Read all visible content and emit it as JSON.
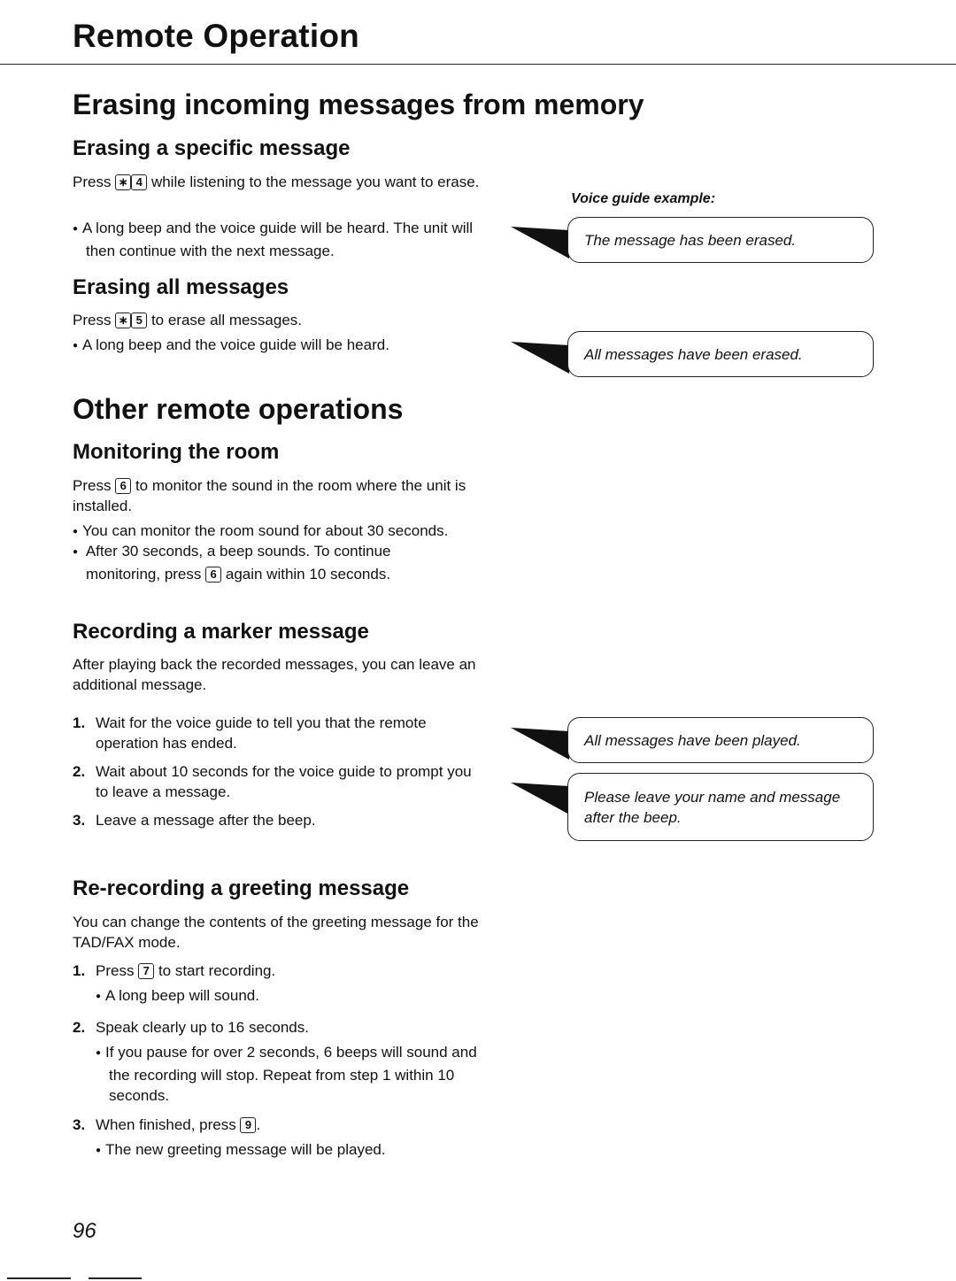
{
  "header": {
    "title": "Remote Operation"
  },
  "section_erasing": {
    "title": "Erasing incoming messages from memory",
    "specific": {
      "heading": "Erasing a specific message",
      "text_before": "Press",
      "keys": [
        "∗",
        "4"
      ],
      "text_after": "while listening to the message you want to erase.",
      "bullets": [
        "A long beep and the voice guide will be heard. The unit will then continue with the next message."
      ]
    },
    "all": {
      "heading": "Erasing all messages",
      "text_before": "Press",
      "keys": [
        "∗",
        "5"
      ],
      "text_after": "to erase all messages.",
      "bullets": [
        "A long beep and the voice guide will be heard."
      ]
    }
  },
  "voice_guide": {
    "label": "Voice guide example:",
    "bubbles": [
      "The message has been erased.",
      "All messages have been erased.",
      "All messages have been played.",
      "Please leave your name and message after the beep."
    ]
  },
  "section_other": {
    "title": "Other remote operations",
    "monitoring": {
      "heading": "Monitoring the room",
      "text_before": "Press",
      "key": "6",
      "text_after": "to monitor the sound in the room where the unit is installed.",
      "bullet1": "You can monitor the room sound for about 30 seconds.",
      "bullet2_before": "After 30 seconds, a beep sounds. To continue monitoring, press",
      "bullet2_key": "6",
      "bullet2_after": "again within 10 seconds."
    },
    "marker": {
      "heading": "Recording a marker message",
      "intro": "After playing back the recorded messages, you can leave an additional message.",
      "steps": [
        {
          "num": "1.",
          "text": "Wait for the voice guide to tell you that the remote operation has ended."
        },
        {
          "num": "2.",
          "text": "Wait about 10 seconds for the voice guide to prompt you to leave a message."
        },
        {
          "num": "3.",
          "text": "Leave a message after the beep."
        }
      ]
    },
    "greeting": {
      "heading": "Re-recording a greeting message",
      "intro": "You can change the contents of the greeting message for the TAD/FAX mode.",
      "step1": {
        "num": "1.",
        "before": "Press",
        "key": "7",
        "after": "to start recording.",
        "bullet": "A long beep will sound."
      },
      "step2": {
        "num": "2.",
        "text": "Speak clearly up to 16 seconds.",
        "bullet": "If you pause for over 2 seconds, 6 beeps will sound and the recording will stop. Repeat from step 1 within 10 seconds."
      },
      "step3": {
        "num": "3.",
        "before": "When finished, press",
        "key": "9",
        "after": ".",
        "bullet": "The new greeting message will be played."
      }
    }
  },
  "footer": {
    "page_number": "96"
  }
}
